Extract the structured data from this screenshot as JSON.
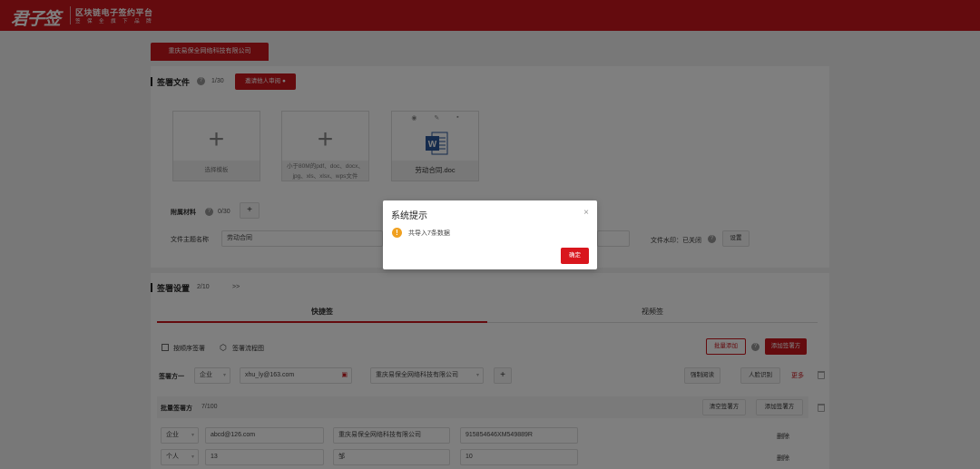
{
  "header": {
    "logo_calligraphy": "君子签",
    "logo_main": "区块链电子签约平台",
    "logo_sub": "签 保 全 旗 下 品 牌"
  },
  "company_tab": "重庆易保全网络科技有限公司",
  "sign_files": {
    "title": "签署文件",
    "count": "1/30",
    "invite_button": "邀请他人审阅",
    "cards": [
      {
        "caption": "选择模板"
      },
      {
        "caption": "小于80M的pdf、doc、docx、jpg、xls、xlsx、wps文件"
      },
      {
        "caption": "劳动合同.doc"
      }
    ],
    "attachments_label": "附属材料",
    "attachments_count": "0/30",
    "attachments_add": "+",
    "topic_label": "文件主题名称",
    "topic_value": "劳动合同",
    "watermark_label": "文件水印：已关闭",
    "watermark_setting": "设置"
  },
  "sign_settings": {
    "title": "签署设置",
    "count": "2/10",
    "expand": ">>",
    "tabs": [
      {
        "label": "快捷签"
      },
      {
        "label": "视频签"
      }
    ],
    "order_checkbox": "按顺序签署",
    "flowchart": "签署流程图",
    "batch_add_button": "批量添加",
    "add_signer_button": "添加签署方",
    "signer_label": "签署方一",
    "signer_type": "企业",
    "signer_email": "xhu_ly@163.com",
    "signer_company": "重庆易保全网络科技有限公司",
    "signer_add": "+",
    "force_read": "强制阅读",
    "face_recognition": "人脸识别",
    "more": "更多",
    "batch_label": "批量签署方",
    "batch_count": "7/100",
    "clear_button": "清空签署方",
    "add_signer_button2": "添加签署方",
    "rows": [
      {
        "type": "企业",
        "account": "abcd@126.com",
        "name": "重庆易保全网络科技有限公司",
        "id": "915854646XM549889R",
        "action": "删除"
      },
      {
        "type": "个人",
        "account": "13",
        "name": "邹",
        "id": "10",
        "action": "删除"
      }
    ]
  },
  "dialog": {
    "title": "系统提示",
    "close": "×",
    "message": "共导入7条数据",
    "confirm": "确定"
  },
  "colors": {
    "brand": "#c8161d",
    "warning": "#f0a020"
  }
}
